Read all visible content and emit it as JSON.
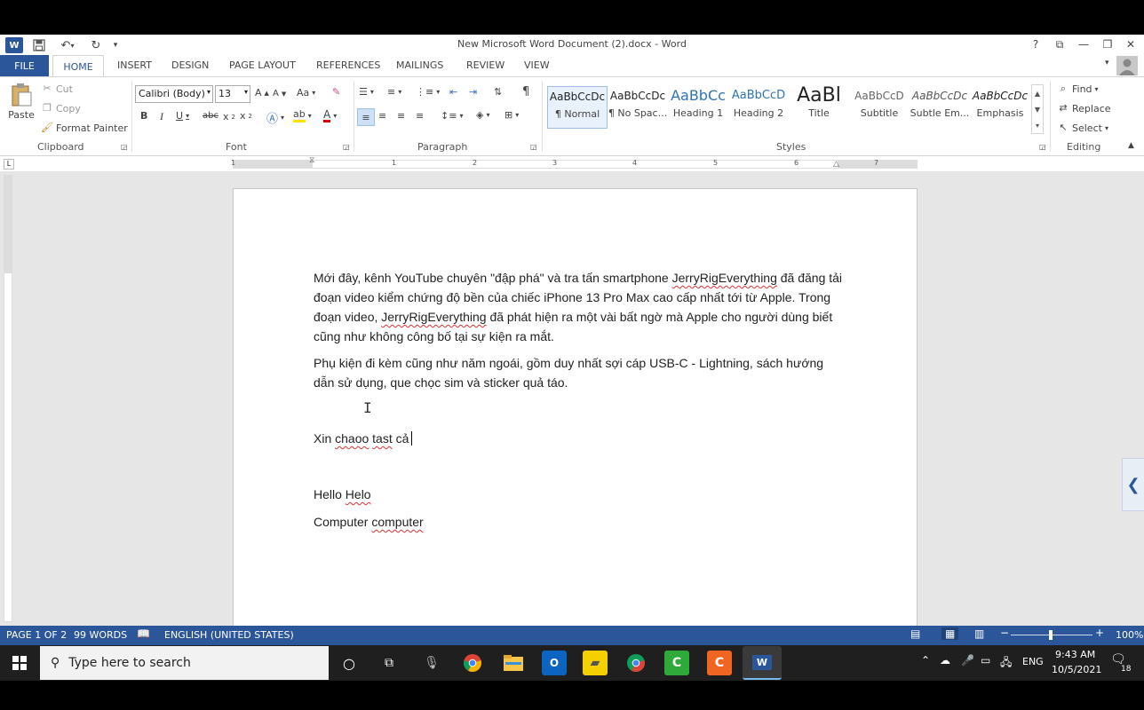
{
  "window": {
    "title": "New Microsoft Word Document (2).docx - Word"
  },
  "quick_access": {
    "undo_icon": "undo-icon",
    "redo_icon": "redo-icon",
    "save_icon": "save-icon"
  },
  "window_controls": {
    "help": "?",
    "ribbon_options": "⧉",
    "minimize": "—",
    "restore": "❐",
    "close": "✕"
  },
  "tabs": [
    "FILE",
    "HOME",
    "INSERT",
    "DESIGN",
    "PAGE LAYOUT",
    "REFERENCES",
    "MAILINGS",
    "REVIEW",
    "VIEW"
  ],
  "ribbon": {
    "clipboard": {
      "label": "Clipboard",
      "paste": "Paste",
      "cut": "Cut",
      "copy": "Copy",
      "format_painter": "Format Painter"
    },
    "font": {
      "label": "Font",
      "font_name": "Calibri (Body)",
      "font_size": "13"
    },
    "paragraph": {
      "label": "Paragraph"
    },
    "styles": {
      "label": "Styles",
      "items": [
        {
          "preview": "AaBbCcDc",
          "name": "¶ Normal"
        },
        {
          "preview": "AaBbCcDc",
          "name": "¶ No Spac..."
        },
        {
          "preview": "AaBbCc",
          "name": "Heading 1"
        },
        {
          "preview": "AaBbCcD",
          "name": "Heading 2"
        },
        {
          "preview": "AaBl",
          "name": "Title"
        },
        {
          "preview": "AaBbCcD",
          "name": "Subtitle"
        },
        {
          "preview": "AaBbCcDc",
          "name": "Subtle Em..."
        },
        {
          "preview": "AaBbCcDc",
          "name": "Emphasis"
        }
      ]
    },
    "editing": {
      "label": "Editing",
      "find": "Find",
      "replace": "Replace",
      "select": "Select"
    }
  },
  "ruler": {
    "numbers": [
      "1",
      "1",
      "2",
      "3",
      "4",
      "5",
      "6",
      "7"
    ]
  },
  "document": {
    "p1_a": "Mới đây, kênh YouTube chuyên \"đập phá\" và tra tấn smartphone ",
    "p1_b": "JerryRigEverything",
    "p1_c": " đã đăng tải đoạn video kiểm chứng độ bền của chiếc iPhone 13 Pro Max cao cấp nhất tới từ Apple. Trong đoạn video, ",
    "p1_d": "JerryRigEverything",
    "p1_e": " đã phát hiện ra một vài bất ngờ mà Apple cho người dùng biết cũng như không công bố tại sự kiện ra mắt.",
    "p2": "Phụ kiện đi kèm cũng như năm ngoái, gồm duy nhất sợi cáp USB-C - Lightning, sách hướng dẫn sử dụng, que chọc sim và sticker quả táo.",
    "p3_a": "Xin ",
    "p3_b": "chaoo",
    "p3_c": " ",
    "p3_d": "tast",
    "p3_e": " cả",
    "p4_a": "Hello ",
    "p4_b": "Helo",
    "p5_a": "Computer ",
    "p5_b": "computer"
  },
  "status": {
    "page": "PAGE 1 OF 2",
    "words": "99 WORDS",
    "language": "ENGLISH (UNITED STATES)",
    "zoom": "100%"
  },
  "taskbar": {
    "search_placeholder": "Type here to search",
    "language": "ENG",
    "time": "9:43 AM",
    "date": "10/5/2021",
    "notifications": "18"
  }
}
